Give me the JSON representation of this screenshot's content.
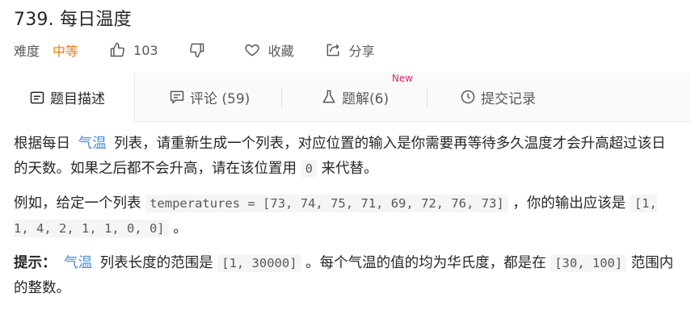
{
  "problem": {
    "title": "739. 每日温度",
    "difficulty_label": "难度",
    "difficulty_value": "中等",
    "likes": "103",
    "favorite_label": "收藏",
    "share_label": "分享"
  },
  "tabs": [
    {
      "label": "题目描述",
      "icon": "description-icon"
    },
    {
      "label": "评论 (59)",
      "icon": "comment-icon"
    },
    {
      "label": "题解(6)",
      "icon": "flask-icon",
      "badge": "New"
    },
    {
      "label": "提交记录",
      "icon": "clock-icon"
    }
  ],
  "content": {
    "p1_a": "根据每日",
    "p1_kw": "气温",
    "p1_b": "列表，请重新生成一个列表，对应位置的输入是你需要再等待多久温度才会升高超过该日的天数。如果之后都不会升高，请在该位置用",
    "p1_code": "0",
    "p1_c": "来代替。",
    "p2_a": "例如，给定一个列表",
    "p2_code1": "temperatures = [73, 74, 75, 71, 69, 72, 76, 73]",
    "p2_b": "，你的输出应该是",
    "p2_code2": "[1, 1, 4, 2, 1, 1, 0, 0]",
    "p2_c": "。",
    "p3_bold": "提示：",
    "p3_kw": "气温",
    "p3_a": "列表长度的范围是",
    "p3_code1": "[1, 30000]",
    "p3_b": "。每个气温的值的均为华氏度，都是在",
    "p3_code2": "[30, 100]",
    "p3_c": "范围内的整数。"
  },
  "colors": {
    "difficulty_medium": "#e97c1d",
    "keyword": "#4a8bd6",
    "new_badge": "#d4266e"
  }
}
